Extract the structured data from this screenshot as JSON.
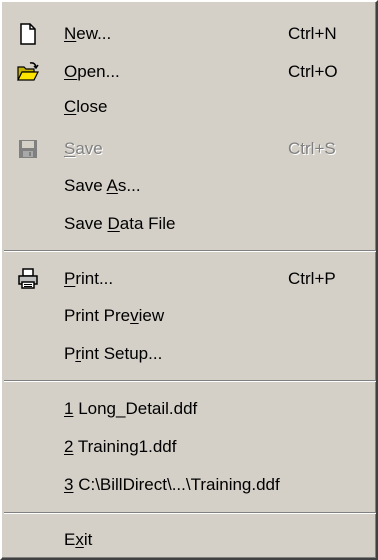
{
  "menu": {
    "new": {
      "label": "New...",
      "mnemonic_index": 0,
      "shortcut": "Ctrl+N",
      "icon": "new-document-icon"
    },
    "open": {
      "label": "Open...",
      "mnemonic_index": 0,
      "shortcut": "Ctrl+O",
      "icon": "open-folder-icon"
    },
    "close": {
      "label": "Close",
      "mnemonic_index": 0
    },
    "save": {
      "label": "Save",
      "mnemonic_index": 0,
      "shortcut": "Ctrl+S",
      "icon": "save-disk-icon",
      "enabled": false
    },
    "save_as": {
      "label": "Save As...",
      "mnemonic_index": 5
    },
    "save_data_file": {
      "label": "Save Data File",
      "mnemonic_index": 5
    },
    "print": {
      "label": "Print...",
      "mnemonic_index": 0,
      "shortcut": "Ctrl+P",
      "icon": "printer-icon"
    },
    "print_preview": {
      "label": "Print Preview",
      "mnemonic_index": 9
    },
    "print_setup": {
      "label": "Print Setup...",
      "mnemonic_index": 1
    },
    "recent_1": {
      "label": "1 Long_Detail.ddf",
      "mnemonic_index": 0
    },
    "recent_2": {
      "label": "2 Training1.ddf",
      "mnemonic_index": 0
    },
    "recent_3": {
      "label": "3 C:\\BillDirect\\...\\Training.ddf",
      "mnemonic_index": 0
    },
    "exit": {
      "label": "Exit",
      "mnemonic_index": 1
    }
  },
  "colors": {
    "menu_bg": "#d4d0c8",
    "disabled_text": "#808080"
  }
}
